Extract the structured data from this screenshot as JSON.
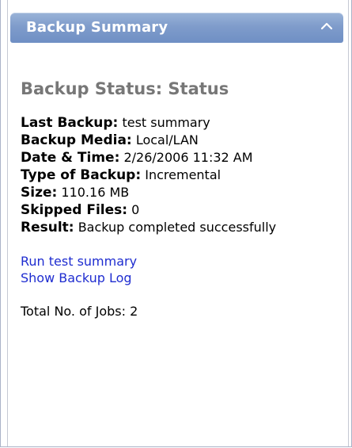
{
  "panel": {
    "title": "Backup Summary",
    "collapse_icon": "chevron-up-icon"
  },
  "status": {
    "heading": "Backup Status: Status"
  },
  "details": [
    {
      "label": "Last Backup:",
      "value": "test summary"
    },
    {
      "label": "Backup Media:",
      "value": "Local/LAN"
    },
    {
      "label": "Date & Time:",
      "value": "2/26/2006 11:32 AM"
    },
    {
      "label": "Type of Backup:",
      "value": "Incremental"
    },
    {
      "label": "Size:",
      "value": "110.16 MB"
    },
    {
      "label": "Skipped Files:",
      "value": "0"
    },
    {
      "label": "Result:",
      "value": "Backup completed successfully"
    }
  ],
  "links": {
    "run": "Run test summary",
    "log": "Show Backup Log"
  },
  "jobs_text": "Total No. of Jobs: 2",
  "colors": {
    "header": "#7f9ccb",
    "link": "#1f2dd0",
    "heading": "#777777"
  }
}
